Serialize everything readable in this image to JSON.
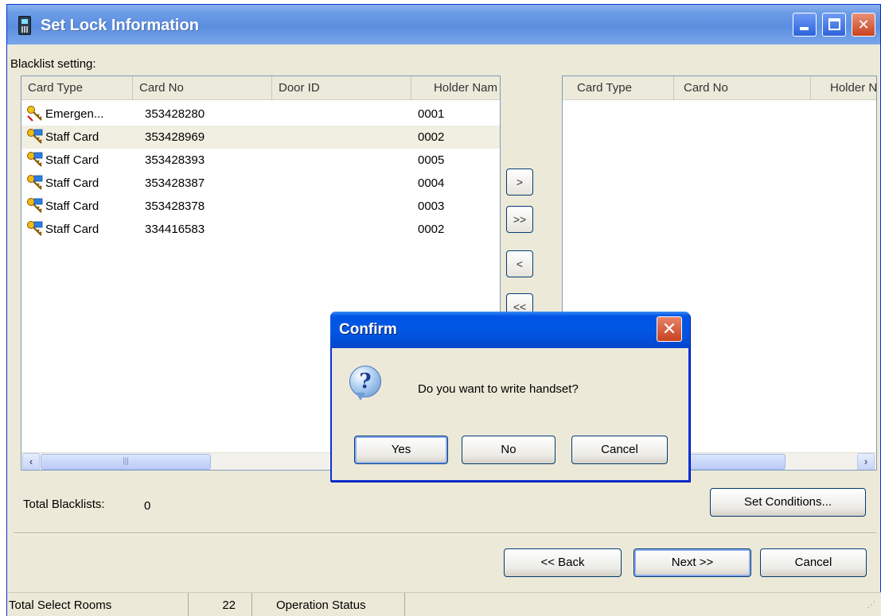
{
  "window": {
    "title": "Set Lock Information"
  },
  "blacklist": {
    "section_label": "Blacklist setting:",
    "columns": [
      "Card Type",
      "Card No",
      "Door ID",
      "Holder Nam"
    ],
    "rows": [
      {
        "type": "Emergen...",
        "card_no": "353428280",
        "door_id": "",
        "holder": "0001",
        "icon": "emergency-key-icon"
      },
      {
        "type": "Staff Card",
        "card_no": "353428969",
        "door_id": "",
        "holder": "0002",
        "icon": "staff-key-icon"
      },
      {
        "type": "Staff Card",
        "card_no": "353428393",
        "door_id": "",
        "holder": "0005",
        "icon": "staff-key-icon"
      },
      {
        "type": "Staff Card",
        "card_no": "353428387",
        "door_id": "",
        "holder": "0004",
        "icon": "staff-key-icon"
      },
      {
        "type": "Staff Card",
        "card_no": "353428378",
        "door_id": "",
        "holder": "0003",
        "icon": "staff-key-icon"
      },
      {
        "type": "Staff Card",
        "card_no": "334416583",
        "door_id": "",
        "holder": "0002",
        "icon": "staff-key-icon"
      }
    ],
    "selected_row": 1
  },
  "selected_list": {
    "columns": [
      "Card Type",
      "Card No",
      "Holder N"
    ]
  },
  "transfer": {
    "add": ">",
    "add_all": ">>",
    "remove": "<",
    "remove_all": "<<"
  },
  "totals": {
    "label": "Total Blacklists:",
    "value": "0"
  },
  "buttons": {
    "set_conditions": "Set Conditions...",
    "back": "<< Back",
    "next": "Next >>",
    "cancel": "Cancel"
  },
  "status_bar": {
    "rooms_label": "Total Select Rooms",
    "rooms_value": "22",
    "operation_label": "Operation Status"
  },
  "dialog": {
    "title": "Confirm",
    "message": "Do you want to write handset?",
    "yes": "Yes",
    "no": "No",
    "cancel": "Cancel"
  },
  "colors": {
    "titlebar_blue": "#0055e5",
    "window_bg": "#ece9d8",
    "selected_row": "#f1efe2"
  }
}
